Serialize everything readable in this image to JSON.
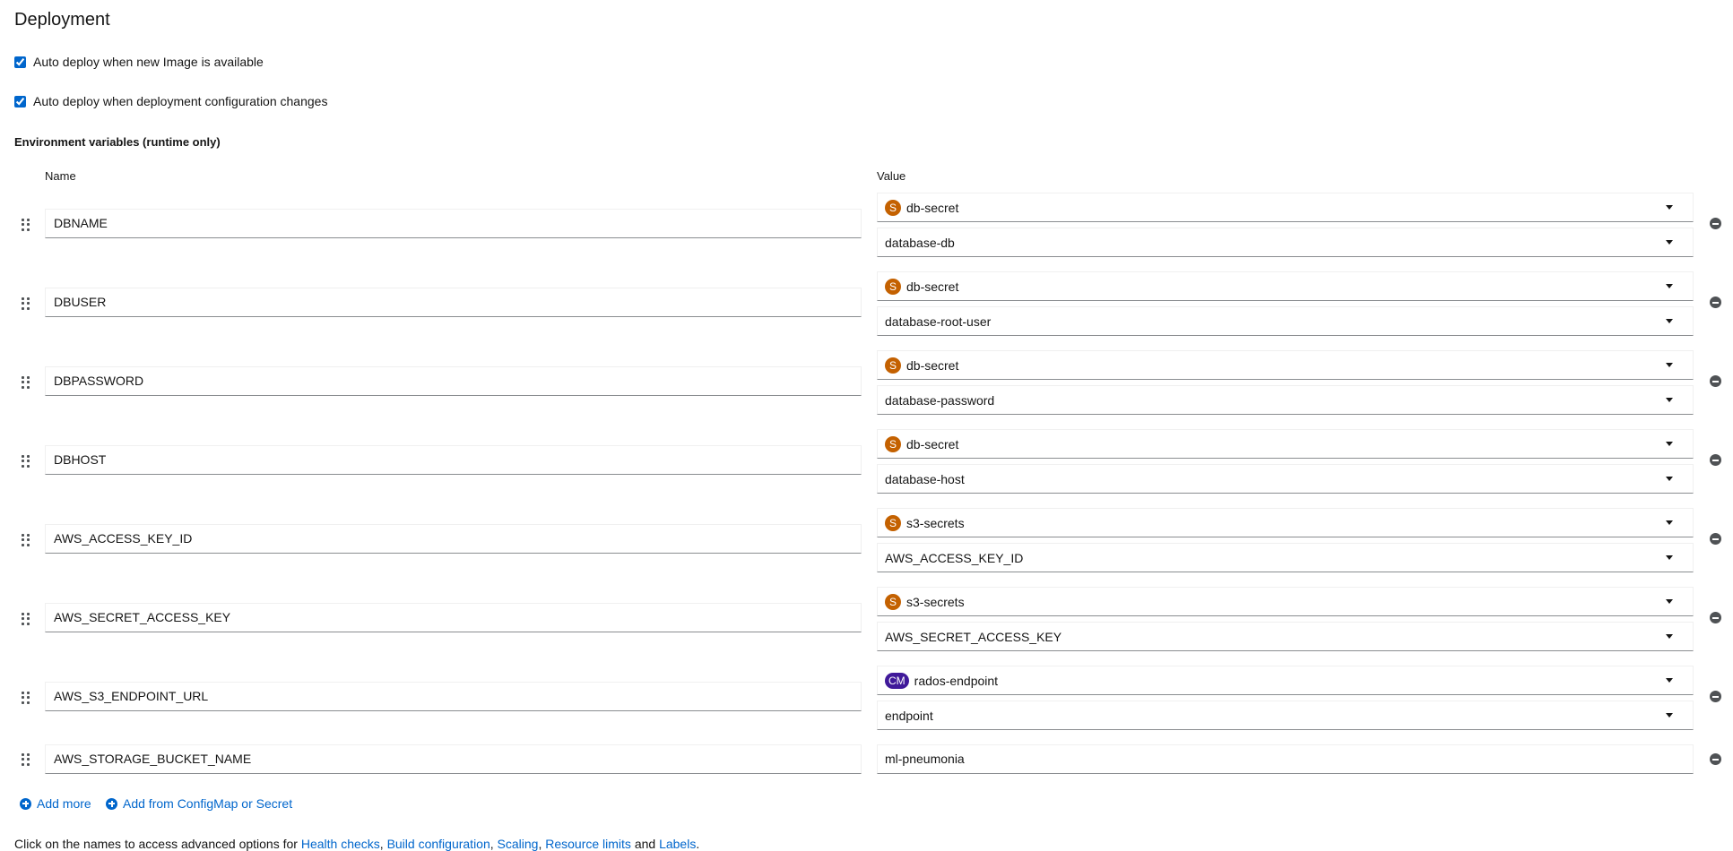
{
  "title": "Deployment",
  "checkboxes": [
    {
      "label": "Auto deploy when new Image is available",
      "checked": true
    },
    {
      "label": "Auto deploy when deployment configuration changes",
      "checked": true
    }
  ],
  "env_section_label": "Environment variables (runtime only)",
  "columns": {
    "name": "Name",
    "value": "Value"
  },
  "env_vars": [
    {
      "name": "DBNAME",
      "source_badge": "S",
      "source": "db-secret",
      "key": "database-db"
    },
    {
      "name": "DBUSER",
      "source_badge": "S",
      "source": "db-secret",
      "key": "database-root-user"
    },
    {
      "name": "DBPASSWORD",
      "source_badge": "S",
      "source": "db-secret",
      "key": "database-password"
    },
    {
      "name": "DBHOST",
      "source_badge": "S",
      "source": "db-secret",
      "key": "database-host"
    },
    {
      "name": "AWS_ACCESS_KEY_ID",
      "source_badge": "S",
      "source": "s3-secrets",
      "key": "AWS_ACCESS_KEY_ID"
    },
    {
      "name": "AWS_SECRET_ACCESS_KEY",
      "source_badge": "S",
      "source": "s3-secrets",
      "key": "AWS_SECRET_ACCESS_KEY"
    },
    {
      "name": "AWS_S3_ENDPOINT_URL",
      "source_badge": "CM",
      "source": "rados-endpoint",
      "key": "endpoint"
    },
    {
      "name": "AWS_STORAGE_BUCKET_NAME",
      "value": "ml-pneumonia"
    }
  ],
  "actions": {
    "add_more": "Add more",
    "add_from_configmap": "Add from ConfigMap or Secret"
  },
  "footer": {
    "prefix": "Click on the names to access advanced options for ",
    "links": [
      "Health checks",
      "Build configuration",
      "Scaling",
      "Resource limits",
      "Labels"
    ],
    "sep1": ", ",
    "sep_and": " and ",
    "suffix": "."
  },
  "colors": {
    "link": "#0066cc",
    "secret_badge": "#c46100",
    "configmap_badge": "#40199a"
  }
}
